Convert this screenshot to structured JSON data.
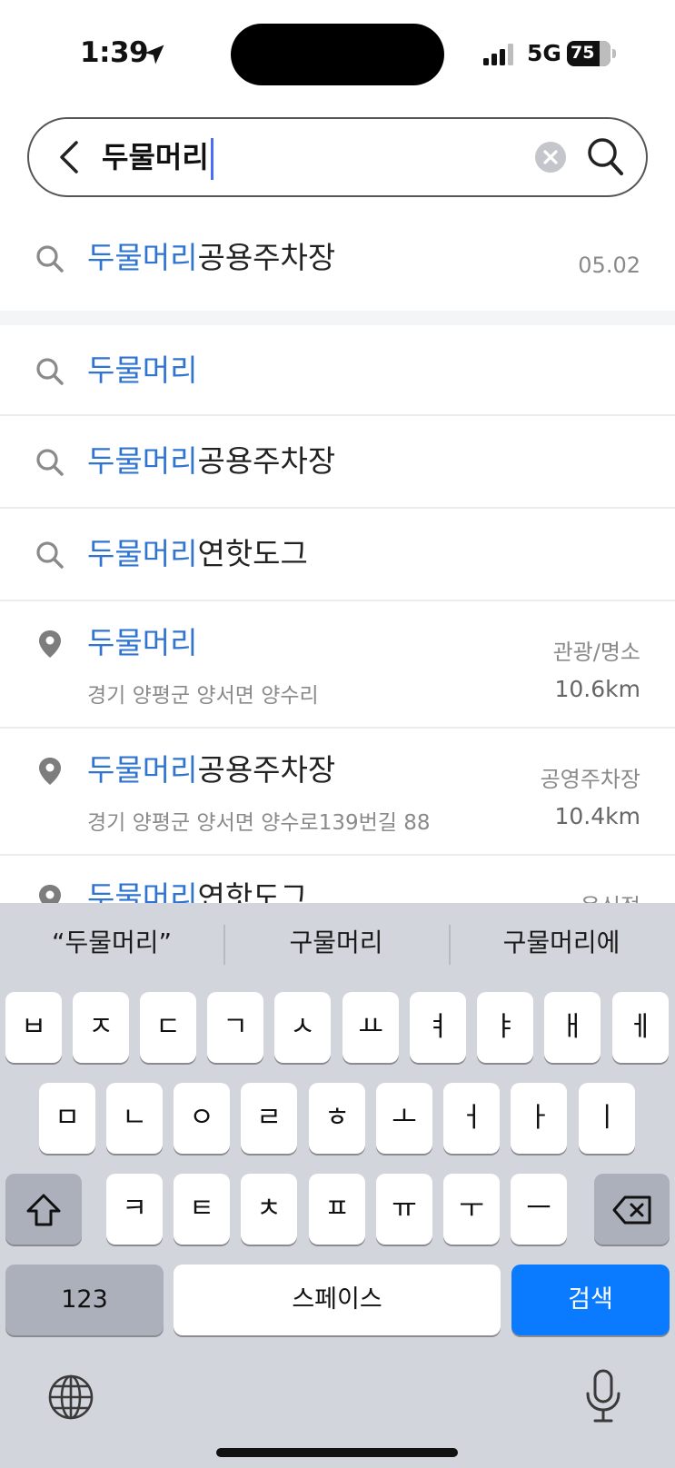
{
  "status_bar": {
    "time": "1:39",
    "network": "5G",
    "battery": "75"
  },
  "search": {
    "query": "두물머리"
  },
  "recent": [
    {
      "highlight": "두물머리",
      "rest": "공용주차장",
      "date": "05.02"
    }
  ],
  "suggestions": [
    {
      "highlight": "두물머리",
      "rest": ""
    },
    {
      "highlight": "두물머리",
      "rest": "공용주차장"
    },
    {
      "highlight": "두물머리",
      "rest": "연핫도그"
    }
  ],
  "places": [
    {
      "highlight": "두물머리",
      "rest": "",
      "address": "경기 양평군 양서면 양수리",
      "category": "관광/명소",
      "distance": "10.6km"
    },
    {
      "highlight": "두물머리",
      "rest": "공용주차장",
      "address": "경기 양평군 양서면 양수로139번길 88",
      "category": "공영주차장",
      "distance": "10.4km"
    },
    {
      "highlight": "두물머리",
      "rest": "연핫도그",
      "category": "음식점"
    }
  ],
  "keyboard": {
    "suggestions": [
      "“두물머리”",
      "구물머리",
      "구물머리에"
    ],
    "row1": [
      "ㅂ",
      "ㅈ",
      "ㄷ",
      "ㄱ",
      "ㅅ",
      "ㅛ",
      "ㅕ",
      "ㅑ",
      "ㅐ",
      "ㅔ"
    ],
    "row2": [
      "ㅁ",
      "ㄴ",
      "ㅇ",
      "ㄹ",
      "ㅎ",
      "ㅗ",
      "ㅓ",
      "ㅏ",
      "ㅣ"
    ],
    "row3": [
      "ㅋ",
      "ㅌ",
      "ㅊ",
      "ㅍ",
      "ㅠ",
      "ㅜ",
      "ㅡ"
    ],
    "numbers_key": "123",
    "space_key": "스페이스",
    "search_key": "검색"
  }
}
